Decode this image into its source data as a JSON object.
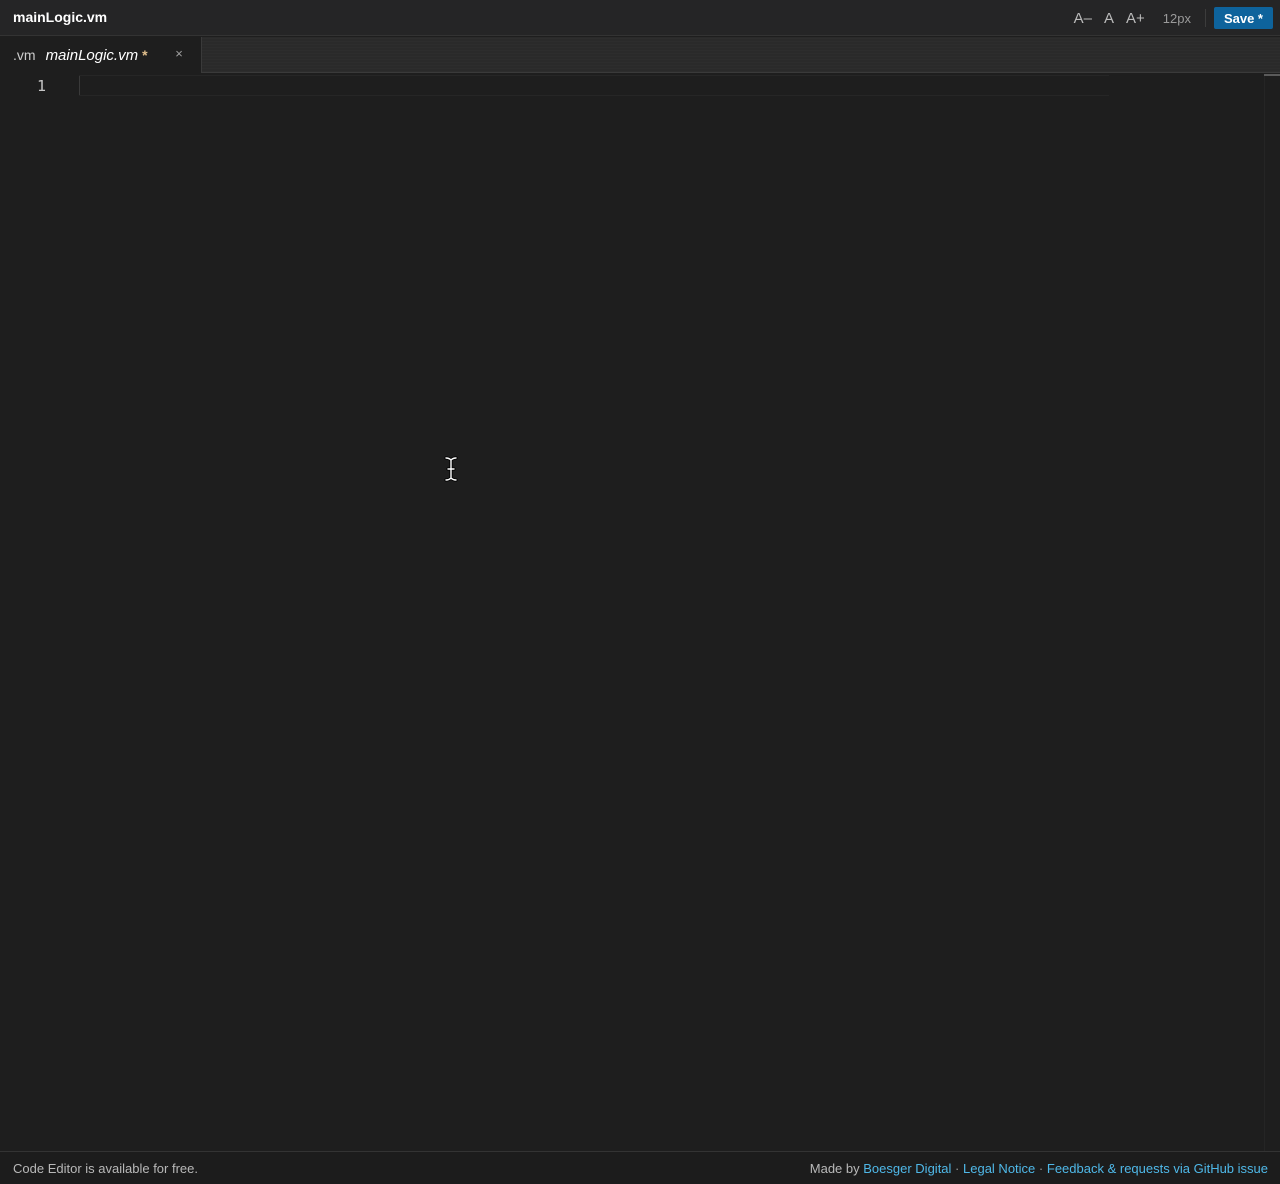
{
  "window": {
    "title": "mainLogic.vm"
  },
  "toolbar": {
    "decrease_font_label": "A–",
    "reset_font_label": "A",
    "increase_font_label": "A+",
    "font_size": "12px",
    "save_label": "Save *"
  },
  "tabs": [
    {
      "extension": ".vm",
      "filename": "mainLogic.vm",
      "dirty_marker": "*",
      "close_label": "×"
    }
  ],
  "editor": {
    "line_numbers": [
      "1"
    ],
    "content": ""
  },
  "footer": {
    "left_text": "Code Editor is available for free.",
    "made_by_prefix": "Made by",
    "company_link": "Boesger Digital",
    "separator": "·",
    "legal_link": "Legal Notice",
    "feedback_link": "Feedback & requests via GitHub issue"
  },
  "colors": {
    "background": "#1e1e1e",
    "save_button": "#0e639c",
    "link": "#4fb8e8",
    "dirty_marker": "#e2c08d"
  }
}
